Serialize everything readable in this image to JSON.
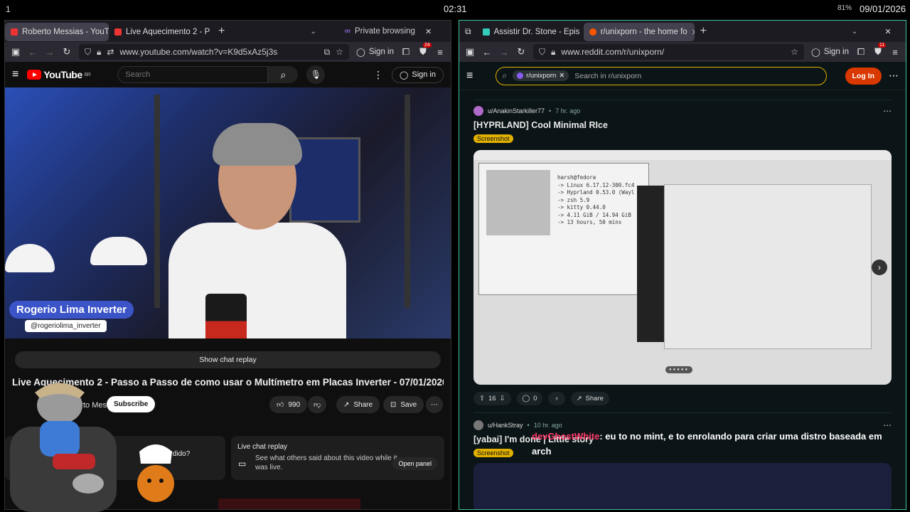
{
  "topbar": {
    "workspace": "1",
    "clock": "02:31",
    "battery": "81%",
    "date": "09/01/2026"
  },
  "left": {
    "tabs": [
      {
        "label": "Roberto Messias - YouT",
        "color": "#e33"
      },
      {
        "label": "Live Aquecimento 2 - P",
        "color": "#e33"
      }
    ],
    "private_label": "Private browsing",
    "url": "www.youtube.com/watch?v=K9d5xAz5j3s",
    "signin": "Sign in",
    "badge": "24",
    "yt": {
      "logo": "YouTube",
      "region": "BR",
      "search_placeholder": "Search",
      "signin": "Sign in",
      "overlay_name": "Rogerio Lima Inverter",
      "overlay_handle": "@rogeriolima_inverter",
      "show_chat": "Show chat replay",
      "title": "Live Aquecimento 2 - Passo a Passo de como usar o Multímetro em Placas Inverter - 07/01/2026",
      "channel": "Roberto Messias",
      "subscribe": "Subscribe",
      "likes": "990",
      "share": "Share",
      "save": "Save",
      "card1_text": "tiu perdido?",
      "card2_title": "Live chat replay",
      "card2_desc": "See what others said about this video while it was live.",
      "open_panel": "Open panel"
    }
  },
  "right": {
    "tabs": [
      {
        "label": "Assistir Dr. Stone - Epis",
        "color": "#3cb"
      },
      {
        "label": "r/unixporn - the home fo",
        "color": "#f50"
      }
    ],
    "url": "www.reddit.com/r/unixporn/",
    "signin": "Sign in",
    "badge": "11",
    "reddit": {
      "chip": "r/unixporn",
      "search_placeholder": "Search in r/unixporn",
      "login": "Log In",
      "post1": {
        "author": "u/AnakinStarkiller77",
        "time": "7 hr. ago",
        "title": "[HYPRLAND] Cool Minimal RIce",
        "flair": "Screenshot",
        "votes": "16",
        "comments": "0",
        "share": "Share"
      },
      "post2": {
        "author": "u/HankStray",
        "time": "10 hr. ago",
        "title": "[yabai] I'm done | Little story",
        "flair": "Screenshot"
      },
      "terminal_lines": "harsh@fedora\n-> Linux 6.17.12-300.fc4\n-> Hyprland 0.53.0 (Wayl\n-> zsh 5.9\n-> kitty 0.44.0\n-> 4.11 GiB / 14.94 GiB\n-> 13 hours, 50 mins"
    }
  },
  "chat": {
    "user": "devGhostWhite",
    "message": ": eu to no mint, e to enrolando para criar uma distro baseada em arch"
  }
}
